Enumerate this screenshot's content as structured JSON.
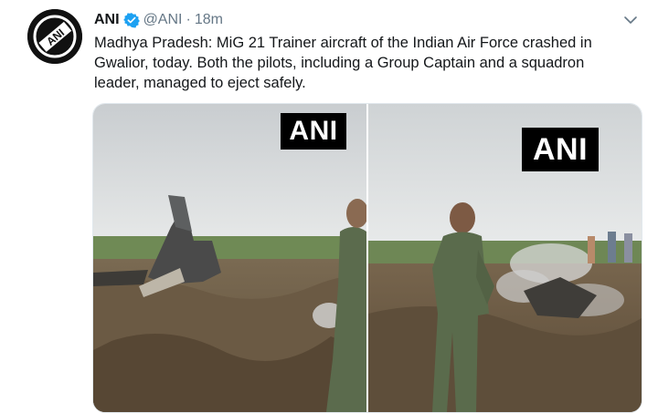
{
  "tweet": {
    "author_name": "ANI",
    "handle": "@ANI",
    "separator": "·",
    "time": "18m",
    "text": "Madhya Pradesh: MiG 21 Trainer aircraft of the Indian Air Force crashed in Gwalior, today. Both the pilots, including a Group Captain and a squadron leader, managed to eject safely.",
    "avatar_text": "ANI",
    "verified_icon": "verified-badge-icon",
    "menu_icon": "chevron-down-icon"
  },
  "media": {
    "photos": [
      {
        "watermark": "ANI"
      },
      {
        "watermark": "ANI"
      }
    ]
  },
  "colors": {
    "verified": "#1da1f2",
    "secondary_text": "#657786",
    "watermark_bg": "#000000"
  }
}
